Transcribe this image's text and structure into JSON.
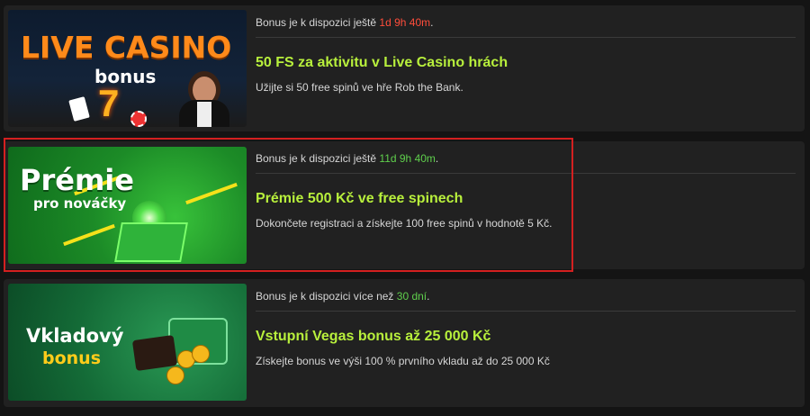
{
  "bonuses": [
    {
      "banner_title": "LIVE CASINO",
      "banner_sub": "bonus",
      "avail_prefix": "Bonus je k dispozici ještě",
      "avail_time": "1d 9h 40m",
      "avail_suffix": ".",
      "title": "50 FS za aktivitu v Live Casino hrách",
      "description": "Užijte si 50 free spinů ve hře Rob the Bank."
    },
    {
      "banner_title": "Prémie",
      "banner_sub": "pro nováčky",
      "avail_prefix": "Bonus je k dispozici ještě",
      "avail_time": "11d 9h 40m",
      "avail_suffix": ".",
      "title": "Prémie 500 Kč ve free spinech",
      "description": "Dokončete registraci a získejte 100 free spinů v hodnotě 5 Kč."
    },
    {
      "banner_title": "Vkladový",
      "banner_sub": "bonus",
      "avail_prefix": "Bonus je k dispozici více než",
      "avail_time": "30 dní",
      "avail_suffix": ".",
      "title": "Vstupní Vegas bonus až 25 000 Kč",
      "description": "Získejte bonus ve výši 100 % prvního vkladu až do 25 000 Kč"
    }
  ],
  "colors": {
    "accent_title": "#b8f03c",
    "time_red": "#ff4d3b",
    "time_green": "#5fcf4c",
    "highlight": "#d42020"
  }
}
